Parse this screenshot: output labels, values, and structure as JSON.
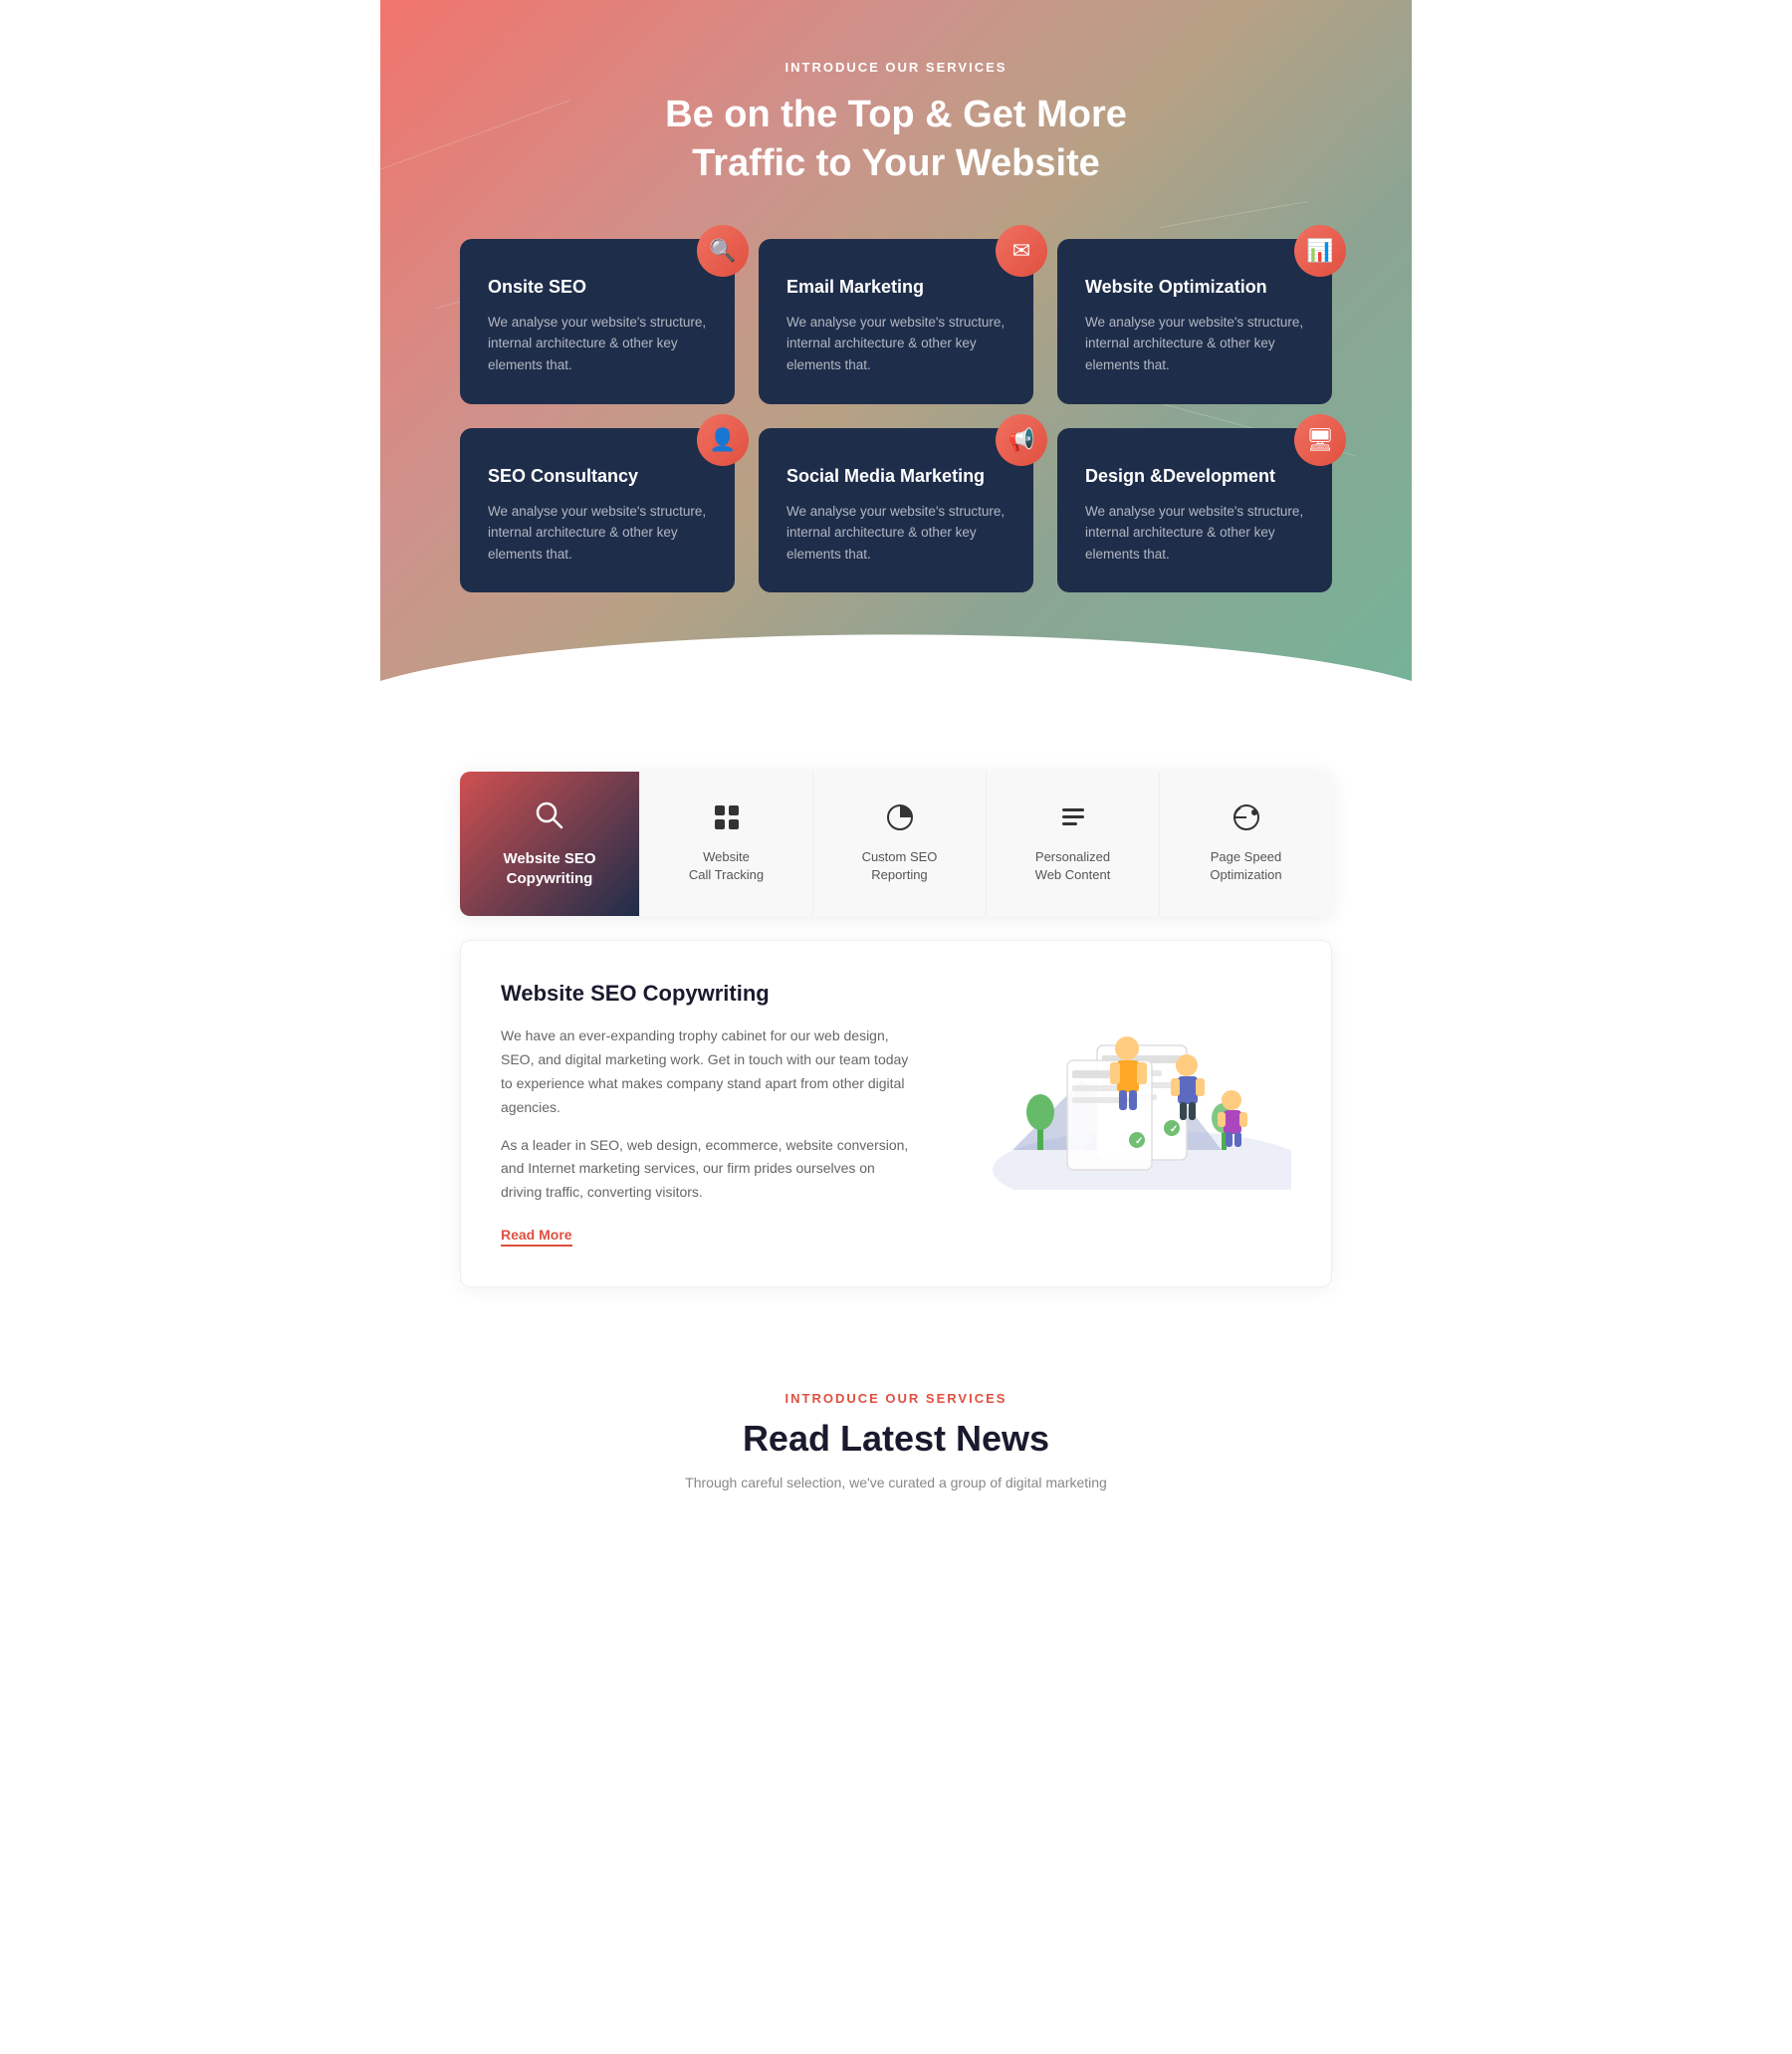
{
  "hero": {
    "section_label": "INTRODUCE OUR SERVICES",
    "title_line1": "Be on the Top & Get More",
    "title_line2": "Traffic to Your Website"
  },
  "services": [
    {
      "id": "onsite-seo",
      "title": "Onsite SEO",
      "desc": "We analyse your website's structure, internal architecture & other key elements that.",
      "icon": "🔍"
    },
    {
      "id": "email-marketing",
      "title": "Email Marketing",
      "desc": "We analyse your website's structure, internal architecture & other key elements that.",
      "icon": "✉"
    },
    {
      "id": "website-optimization",
      "title": "Website Optimization",
      "desc": "We analyse your website's structure, internal architecture & other key elements that.",
      "icon": "📊"
    },
    {
      "id": "seo-consultancy",
      "title": "SEO Consultancy",
      "desc": "We analyse your website's structure, internal architecture & other key elements that.",
      "icon": "👤"
    },
    {
      "id": "social-media",
      "title": "Social Media Marketing",
      "desc": "We analyse your website's structure, internal architecture & other key elements that.",
      "icon": "📢"
    },
    {
      "id": "design-dev",
      "title": "Design &Development",
      "desc": "We analyse your website's structure, internal architecture & other key elements that.",
      "icon": "🖥"
    }
  ],
  "tabs": [
    {
      "id": "website-seo-copywriting",
      "label_line1": "Website SEO",
      "label_line2": "Copywriting",
      "icon": "🔍",
      "active": true
    },
    {
      "id": "website-call-tracking",
      "label_line1": "Website",
      "label_line2": "Call Tracking",
      "icon": "≡",
      "active": false
    },
    {
      "id": "custom-seo-reporting",
      "label_line1": "Custom SEO",
      "label_line2": "Reporting",
      "icon": "◕",
      "active": false
    },
    {
      "id": "personalized-web-content",
      "label_line1": "Personalized",
      "label_line2": "Web Content",
      "icon": "≣",
      "active": false
    },
    {
      "id": "page-speed-optimization",
      "label_line1": "Page Speed",
      "label_line2": "Optimization",
      "icon": "⊙",
      "active": false
    }
  ],
  "tab_content": {
    "title": "Website SEO Copywriting",
    "body1": "We have an ever-expanding trophy cabinet for our web design, SEO, and digital marketing work. Get in touch with our team today to experience what makes company stand apart from other digital agencies.",
    "body2": "As a leader in SEO, web design, ecommerce, website conversion, and Internet marketing services, our firm prides ourselves on driving traffic, converting visitors.",
    "read_more": "Read More"
  },
  "news": {
    "section_label": "INTRODUCE OUR SERVICES",
    "title": "Read Latest News",
    "subtitle": "Through careful selection, we've curated a group of digital marketing"
  }
}
